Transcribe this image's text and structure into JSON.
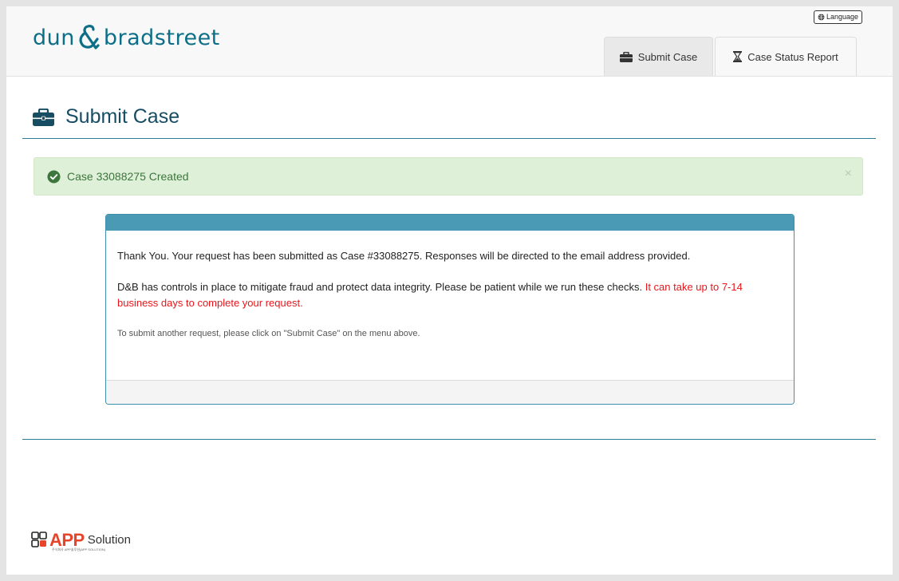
{
  "header": {
    "logo_left": "dun",
    "logo_right": "bradstreet",
    "language_label": "Language",
    "tabs": [
      {
        "label": "Submit Case",
        "icon": "briefcase-icon",
        "active": true
      },
      {
        "label": "Case Status Report",
        "icon": "hourglass-icon",
        "active": false
      }
    ]
  },
  "page": {
    "title": "Submit Case",
    "title_icon": "briefcase-icon"
  },
  "alert": {
    "message": "Case 33088275 Created",
    "close": "×",
    "status_color": "#3c763d"
  },
  "panel": {
    "thank_you": "Thank You. Your request has been submitted as Case #33088275. Responses will be directed to the email address provided.",
    "controls_text": "D&B has controls in place to mitigate fraud and protect data integrity. Please be patient while we run these checks.",
    "timeline_text": "It can take up to 7-14 business days to complete your request.",
    "instruction": "To submit another request, please click on \"Submit Case\" on the menu above."
  },
  "footer": {
    "brand_app": "APP",
    "brand_solution": "Solution",
    "brand_sub": "주식회사 APP솔루션(APP SOLUTION)"
  },
  "colors": {
    "brand_teal": "#0d6f87",
    "panel_header": "#4b9ab5",
    "warning_red": "#e8161b",
    "alert_bg": "#dff0d8"
  }
}
